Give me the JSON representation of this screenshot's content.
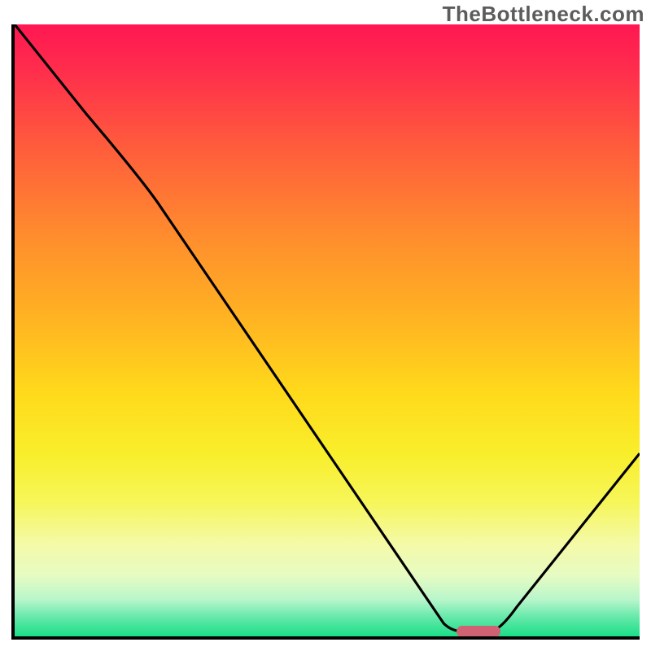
{
  "watermark": "TheBottleneck.com",
  "chart_data": {
    "type": "line",
    "title": "",
    "xlabel": "",
    "ylabel": "",
    "xlim": [
      0,
      100
    ],
    "ylim": [
      0,
      100
    ],
    "series": [
      {
        "name": "bottleneck-curve",
        "x": [
          0,
          20,
          68,
          72,
          76,
          100
        ],
        "y": [
          100,
          72,
          1,
          0,
          1,
          30
        ]
      }
    ],
    "optimal_marker": {
      "x": 72,
      "width_pct": 6
    },
    "gradient_stops": [
      {
        "pct": 0,
        "color": "#ff1752"
      },
      {
        "pct": 60,
        "color": "#ffd91b"
      },
      {
        "pct": 100,
        "color": "#1adf88"
      }
    ]
  }
}
